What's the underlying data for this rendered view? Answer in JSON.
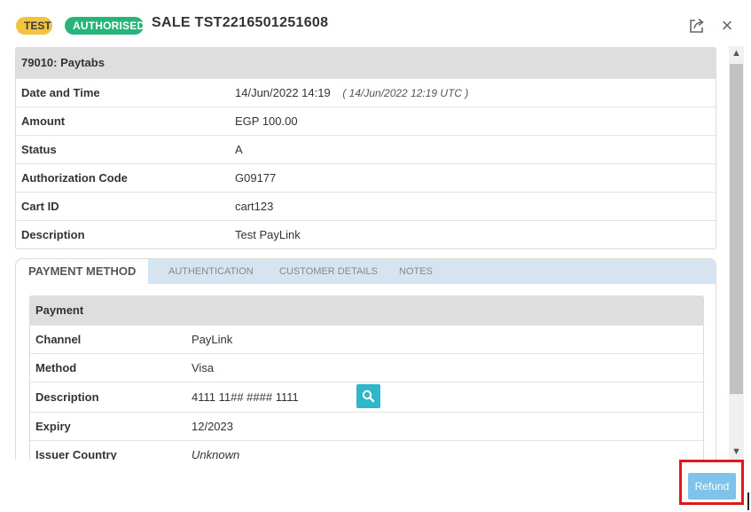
{
  "header": {
    "badge_test": "TEST",
    "badge_authorised": "AUTHORISED",
    "title": "SALE  TST2216501251608",
    "share_icon": "share-external-icon",
    "close_icon": "close-icon",
    "close_glyph": "×"
  },
  "merchant": {
    "heading": "79010: Paytabs",
    "rows": [
      {
        "label": "Date and Time",
        "value": "14/Jun/2022 14:19",
        "secondary": "( 14/Jun/2022 12:19 UTC )"
      },
      {
        "label": "Amount",
        "value": "EGP 100.00"
      },
      {
        "label": "Status",
        "value": "A"
      },
      {
        "label": "Authorization Code",
        "value": "G09177"
      },
      {
        "label": "Cart ID",
        "value": "cart123"
      },
      {
        "label": "Description",
        "value": "Test PayLink"
      }
    ]
  },
  "tabs": [
    {
      "label": "PAYMENT METHOD",
      "active": true
    },
    {
      "label": "AUTHENTICATION",
      "active": false
    },
    {
      "label": "CUSTOMER DETAILS",
      "active": false
    },
    {
      "label": "NOTES",
      "active": false
    }
  ],
  "payment": {
    "heading": "Payment",
    "rows": [
      {
        "label": "Channel",
        "value": "PayLink"
      },
      {
        "label": "Method",
        "value": "Visa"
      },
      {
        "label": "Description",
        "value": "4111 11## #### 1111",
        "action_icon": "search-icon"
      },
      {
        "label": "Expiry",
        "value": "12/2023"
      },
      {
        "label": "Issuer Country",
        "value": "Unknown"
      }
    ]
  },
  "footer": {
    "refund_label": "Refund"
  },
  "colors": {
    "badge_test": "#f3c33f",
    "badge_authorised": "#26b47a",
    "tab_bar": "#d6e3f1",
    "search_button": "#2fb6c9",
    "refund_button": "#7fc3ea",
    "highlight": "#e0191b"
  }
}
